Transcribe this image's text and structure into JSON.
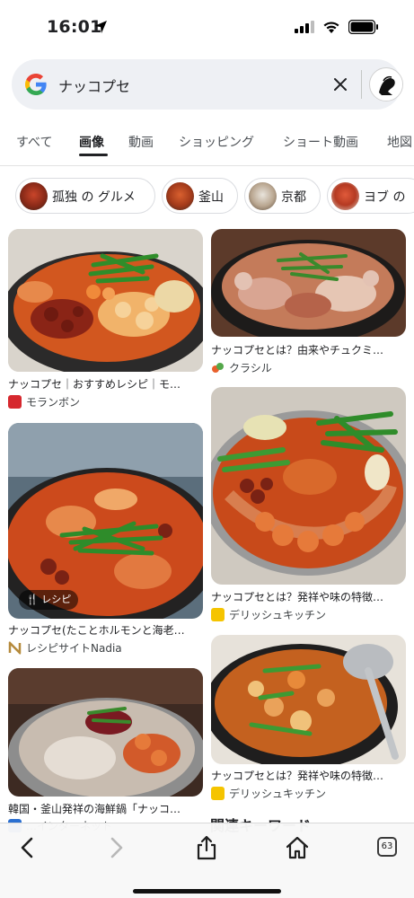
{
  "status": {
    "time": "16:01"
  },
  "search": {
    "query": "ナッコプセ"
  },
  "tabs": [
    {
      "label": "すべて"
    },
    {
      "label": "画像"
    },
    {
      "label": "動画"
    },
    {
      "label": "ショッピング"
    },
    {
      "label": "ショート動画"
    },
    {
      "label": "地図"
    }
  ],
  "chips": [
    {
      "label": "孤独 の グルメ"
    },
    {
      "label": "釜山"
    },
    {
      "label": "京都"
    },
    {
      "label": "ヨブ の"
    }
  ],
  "results": [
    {
      "title": "ナッコプセ｜おすすめレシピ｜モ…",
      "source": "モランボン",
      "fav_color": "#d6282e"
    },
    {
      "title": "ナッコプセとは？由来やチュクミ…",
      "source": "クラシル",
      "fav_color": "#e8602c"
    },
    {
      "title": "ナッコプセ(たことホルモンと海老…",
      "source": "レシピサイトNadia",
      "badge": "レシピ",
      "fav_color": "#b58a3c"
    },
    {
      "title": "ナッコプセとは？発祥や味の特徴…",
      "source": "デリッシュキッチン",
      "fav_color": "#f5c400"
    },
    {
      "title": "韓国・釜山発祥の海鮮鍋「ナッコ…",
      "source": "…インターネット",
      "fav_color": "#2a6fd1"
    },
    {
      "title": "ナッコプセとは？発祥や味の特徴…",
      "source": "デリッシュキッチン",
      "fav_color": "#f5c400"
    }
  ],
  "related_heading": "関連キーワード",
  "bottombar": {
    "tab_count": "63"
  }
}
